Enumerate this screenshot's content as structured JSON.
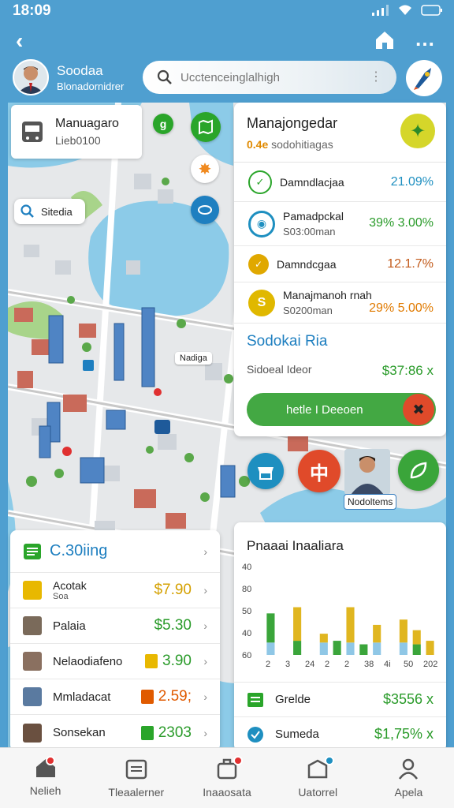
{
  "status_bar": {
    "time": "18:09"
  },
  "profile": {
    "name": "Soodaa",
    "subtitle": "Blonadornidrer"
  },
  "search": {
    "placeholder": "Ucctenceinglalhigh"
  },
  "map": {
    "location_card": {
      "title": "Manuagaro",
      "subtitle": "Lieb0100"
    },
    "search_chip": {
      "label": "Sitedia"
    },
    "pin_label_1": "Nadiga",
    "pin_label_2": "Nodoltems",
    "person_label": "Nodoltems"
  },
  "info_panel": {
    "title": "Manajongedar",
    "subtitle_highlight": "0.4e",
    "subtitle": "sodohitiagas",
    "rows": [
      {
        "label": "Damndlacjaa",
        "value": "21.09%",
        "icon": "shield-icon",
        "color": "#2aa52a",
        "value_color": "#1e8fc0"
      },
      {
        "label": "Pamadpckal",
        "sub": "S03:00man",
        "value": "39% 3.00%",
        "icon": "camera-icon",
        "color": "#1e8fc0",
        "value_color": "#2a9b2a"
      },
      {
        "label": "Damndcgaa",
        "value": "12.1.7%",
        "icon": "badge-icon",
        "color": "#e0a800",
        "value_color": "#c25a1a"
      },
      {
        "label": "Manajmanoh rnah",
        "sub": "S0200man",
        "value": "29% 5.00%",
        "icon": "coin-icon",
        "color": "#e0b800",
        "value_color": "#e07a00"
      }
    ],
    "footer_title": "Sodokai Ria",
    "footer_label": "Sidoeal Ideor",
    "footer_value": "$37:86 x",
    "action_button": "hetle I Deeoen"
  },
  "list_card": {
    "title": "C.30iing",
    "items": [
      {
        "name": "Acotak",
        "sub": "Soa",
        "value": "$7.90",
        "value_color": "#d4a000",
        "icon_color": "#e8b800"
      },
      {
        "name": "Palaia",
        "value": "$5.30",
        "value_color": "#2a9b2a",
        "icon_color": "#7a6a5a"
      },
      {
        "name": "Nelaodiafeno",
        "value": "3.90",
        "value_color": "#2a9b2a",
        "icon_color": "#8a7060",
        "badge_color": "#e8b800"
      },
      {
        "name": "Mmladacat",
        "value": "2.59;",
        "value_color": "#e05a00",
        "icon_color": "#5a7aa0",
        "badge_color": "#e05a00"
      },
      {
        "name": "Sonsekan",
        "value": "2303",
        "value_color": "#2a9b2a",
        "icon_color": "#6a5040",
        "badge_color": "#2aa52a"
      }
    ]
  },
  "chart_card": {
    "title": "Pnaaai Inaaliara",
    "rows": [
      {
        "name": "Grelde",
        "value": "$3556 x",
        "icon": "grid-icon",
        "icon_color": "#2aa52a"
      },
      {
        "name": "Sumeda",
        "value": "$1,75% x",
        "icon": "shield-icon",
        "icon_color": "#1e8fc0"
      }
    ]
  },
  "chart_data": {
    "type": "bar",
    "yticks": [
      "40",
      "80",
      "50",
      "40",
      "60"
    ],
    "xticks": [
      "2",
      "3",
      "24",
      "2",
      "2",
      "38",
      "4i",
      "50",
      "202"
    ],
    "series": [
      {
        "color": "#8fc7e6",
        "values": [
          14,
          0,
          0,
          0,
          14,
          0,
          14,
          0,
          14,
          0,
          14,
          0,
          0
        ]
      },
      {
        "color": "#3aa53a",
        "values": [
          33,
          0,
          16,
          0,
          0,
          16,
          0,
          12,
          0,
          0,
          0,
          12,
          0
        ]
      },
      {
        "color": "#e0b620",
        "values": [
          0,
          0,
          38,
          0,
          10,
          0,
          40,
          0,
          20,
          0,
          26,
          16,
          16
        ]
      }
    ],
    "ylim": [
      0,
      100
    ]
  },
  "tabs": [
    {
      "label": "Nelieh",
      "icon": "home-icon",
      "badge_color": "#e03030"
    },
    {
      "label": "Tleaalerner",
      "icon": "calendar-icon"
    },
    {
      "label": "Inaaosata",
      "icon": "briefcase-icon",
      "badge_color": "#e03030"
    },
    {
      "label": "Uatorrel",
      "icon": "box-icon",
      "badge_color": "#1e8fc0"
    },
    {
      "label": "Apela",
      "icon": "person-icon"
    }
  ]
}
